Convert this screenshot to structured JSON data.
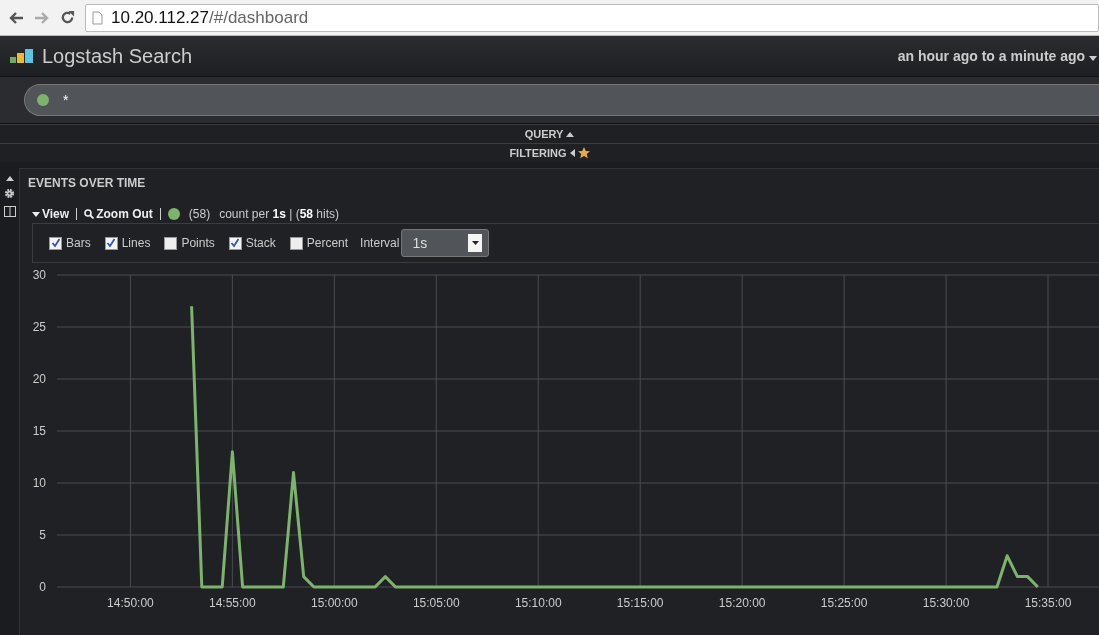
{
  "browser": {
    "url_host": "10.20.112.27",
    "url_path": "/#/dashboard"
  },
  "header": {
    "title": "Logstash Search",
    "timespan": "an hour ago to a minute ago"
  },
  "query": {
    "value": "*",
    "color": "#7cb46c"
  },
  "rows": [
    {
      "label": "QUERY",
      "kind": "up"
    },
    {
      "label": "FILTERING",
      "kind": "left-star"
    }
  ],
  "panel": {
    "title": "EVENTS OVER TIME",
    "legend": {
      "view": "View",
      "zoom_out": "Zoom Out",
      "count": "(58)",
      "summary": "count per **1s** | (**58** hits)",
      "color": "#7cb46c"
    },
    "options": [
      {
        "label": "Bars",
        "checked": true
      },
      {
        "label": "Lines",
        "checked": true
      },
      {
        "label": "Points",
        "checked": false
      },
      {
        "label": "Stack",
        "checked": true
      },
      {
        "label": "Percent",
        "checked": false
      }
    ],
    "interval": {
      "label": "Interval",
      "value": "1s"
    },
    "chart_data": {
      "type": "line",
      "grid": true,
      "ylim": [
        0,
        30
      ],
      "yticks": [
        0,
        5,
        10,
        15,
        20,
        25,
        30
      ],
      "categories": [
        null,
        null,
        null,
        null,
        null,
        null,
        null,
        "14:50:00",
        null,
        null,
        null,
        null,
        null,
        null,
        null,
        null,
        null,
        "14:55:00",
        null,
        null,
        null,
        null,
        null,
        null,
        null,
        null,
        null,
        "15:00:00",
        null,
        null,
        null,
        null,
        null,
        null,
        null,
        null,
        null,
        "15:05:00",
        null,
        null,
        null,
        null,
        null,
        null,
        null,
        null,
        null,
        "15:10:00",
        null,
        null,
        null,
        null,
        null,
        null,
        null,
        null,
        null,
        "15:15:00",
        null,
        null,
        null,
        null,
        null,
        null,
        null,
        null,
        null,
        "15:20:00",
        null,
        null,
        null,
        null,
        null,
        null,
        null,
        null,
        null,
        "15:25:00",
        null,
        null,
        null,
        null,
        null,
        null,
        null,
        null,
        null,
        "15:30:00",
        null,
        null,
        null,
        null,
        null,
        null,
        null,
        null,
        null,
        "15:35:00",
        null,
        null,
        null,
        null
      ],
      "series": [
        {
          "color": "#7cb46c",
          "values": [
            null,
            null,
            null,
            null,
            null,
            null,
            null,
            null,
            null,
            null,
            null,
            null,
            null,
            27,
            0,
            0,
            0,
            13,
            0,
            0,
            0,
            0,
            0,
            11,
            1,
            0,
            0,
            0,
            0,
            0,
            0,
            0,
            1,
            0,
            0,
            0,
            0,
            0,
            0,
            0,
            0,
            0,
            0,
            0,
            0,
            0,
            0,
            0,
            0,
            0,
            0,
            0,
            0,
            0,
            0,
            0,
            0,
            0,
            0,
            0,
            0,
            0,
            0,
            0,
            0,
            0,
            0,
            0,
            0,
            0,
            0,
            0,
            0,
            0,
            0,
            0,
            0,
            0,
            0,
            0,
            0,
            0,
            0,
            0,
            0,
            0,
            0,
            0,
            0,
            0,
            0,
            0,
            0,
            3,
            1,
            1,
            0,
            null,
            null,
            null,
            null,
            null
          ]
        }
      ]
    }
  }
}
